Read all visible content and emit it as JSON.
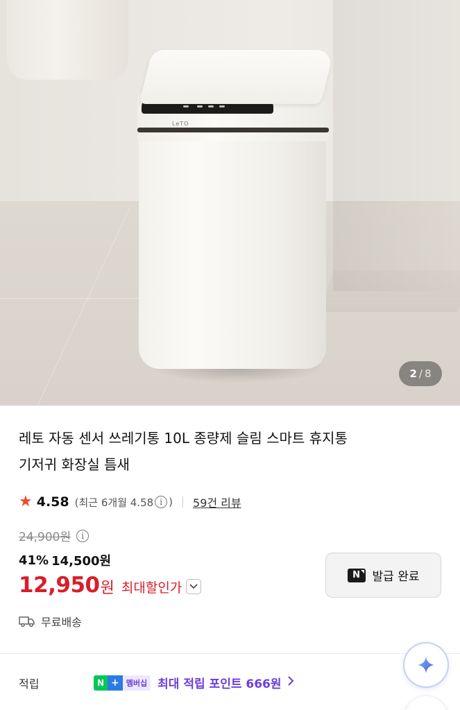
{
  "gallery": {
    "current": "2",
    "separator": "/",
    "total": "8",
    "image_alt": "LETO automatic sensor trash can product photo",
    "brand_logo": "LeTO"
  },
  "product": {
    "title_line1": "레토 자동 센서 쓰레기통 10L 종량제 슬림 스마트 휴지통",
    "title_line2": "기저귀 화장실 틈새"
  },
  "rating": {
    "score": "4.58",
    "recent_label": "(최근 6개월 4.58",
    "recent_close": ")",
    "reviews_link": "59건 리뷰"
  },
  "price": {
    "original": "24,900원",
    "discount_percent": "41%",
    "discounted": "14,500원",
    "best_price": "12,950",
    "best_currency": "원",
    "best_label": "최대할인가"
  },
  "coupon": {
    "badge": "N",
    "label": "발급 완료"
  },
  "shipping": {
    "label": "무료배송"
  },
  "points": {
    "label": "적립",
    "badge_n": "N",
    "badge_plus": "+",
    "badge_membership": "멤버십",
    "text": "최대 적립 포인트 666원"
  },
  "icons": {
    "star": "star-icon",
    "info": "info-icon",
    "chevron": "chevron-down-icon",
    "truck": "truck-icon",
    "arrow": "chevron-right-icon",
    "assistant": "sparkle-icon"
  },
  "colors": {
    "accent_red": "#d81e2a",
    "star_orange": "#f04a2b",
    "membership_purple": "#6a3fd8",
    "naver_green": "#03c75a"
  }
}
